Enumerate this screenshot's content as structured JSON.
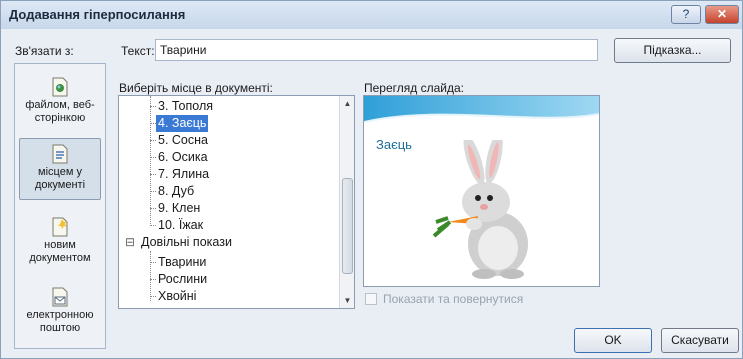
{
  "window": {
    "title": "Додавання гіперпосилання"
  },
  "titlebar": {
    "help_label": "?",
    "close_label": "✕"
  },
  "link_to_label": "Зв'язати з:",
  "text": {
    "label": "Текст:",
    "value": "Тварини"
  },
  "tip_button": "Підказка...",
  "link_targets": [
    {
      "label": "файлом, веб-сторінкою",
      "icon": "file-web-icon"
    },
    {
      "label": "місцем у документі",
      "icon": "place-in-document-icon",
      "selected": true
    },
    {
      "label": "новим документом",
      "icon": "new-document-icon"
    },
    {
      "label": "електронною поштою",
      "icon": "email-icon"
    }
  ],
  "choose_place_label": "Виберіть місце в документі:",
  "tree_items": [
    {
      "label": "3. Тополя"
    },
    {
      "label": "4. Заєць",
      "selected": true
    },
    {
      "label": "5. Сосна"
    },
    {
      "label": "6. Осика"
    },
    {
      "label": "7. Ялина"
    },
    {
      "label": "8. Дуб"
    },
    {
      "label": "9. Клен"
    },
    {
      "label": "10. Їжак"
    },
    {
      "label": "Довільні покази",
      "toggle": "⊟"
    },
    {
      "label": "Тварини"
    },
    {
      "label": "Рослини"
    },
    {
      "label": "Хвойні"
    }
  ],
  "preview": {
    "label": "Перегляд слайда:",
    "slide_title": "Заєць"
  },
  "show_and_return": "Показати та повернутися",
  "ok_button": "OK",
  "cancel_button": "Скасувати"
}
